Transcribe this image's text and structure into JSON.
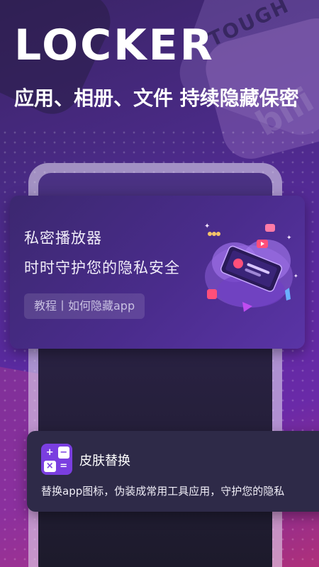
{
  "hero": {
    "title": "LOCKER",
    "subtitle": "应用、相册、文件 持续隐藏保密"
  },
  "background": {
    "word_top": "TOUGH",
    "word_side": "bili"
  },
  "player_card": {
    "title": "私密播放器",
    "description": "时时守护您的隐私安全",
    "tutorial_link": "教程丨如何隐藏app"
  },
  "skin_card": {
    "title": "皮肤替换",
    "description": "替换app图标，伪装成常用工具应用，守护您的隐私",
    "calc_symbols": [
      "+",
      "−",
      "×",
      "="
    ]
  },
  "colors": {
    "accent": "#7a3ee0",
    "card_bg": "#2e2a48",
    "player_bg": "#4a2c8c"
  }
}
